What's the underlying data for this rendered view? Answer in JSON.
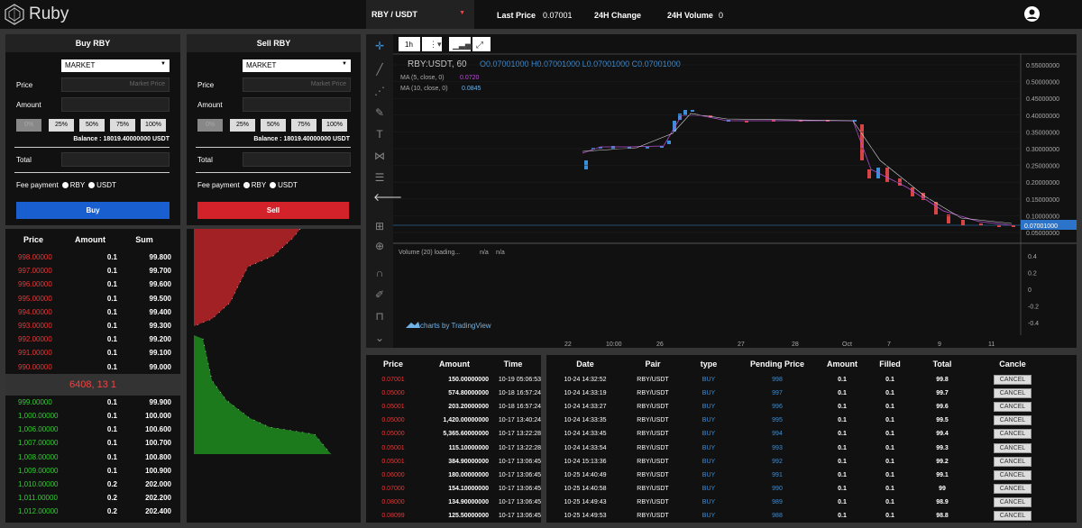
{
  "header": {
    "logo_text": "Ruby",
    "pair": "RBY / USDT",
    "last_price_label": "Last Price",
    "last_price": "0.07001",
    "change_label": "24H Change",
    "volume_label": "24H Volume",
    "volume": "0"
  },
  "buy": {
    "title": "Buy RBY",
    "order_type": "MARKET",
    "price_label": "Price",
    "price_placeholder": "Market Price",
    "amount_label": "Amount",
    "pcts": [
      "0%",
      "25%",
      "50%",
      "75%",
      "100%"
    ],
    "balance": "Balance : 18019.40000000 USDT",
    "total_label": "Total",
    "fee_label": "Fee payment",
    "fee_opt1": "RBY",
    "fee_opt2": "USDT",
    "button": "Buy"
  },
  "sell": {
    "title": "Sell RBY",
    "order_type": "MARKET",
    "price_label": "Price",
    "price_placeholder": "Market Price",
    "amount_label": "Amount",
    "pcts": [
      "0%",
      "25%",
      "50%",
      "75%",
      "100%"
    ],
    "balance": "Balance : 18019.40000000 USDT",
    "total_label": "Total",
    "fee_label": "Fee payment",
    "fee_opt1": "RBY",
    "fee_opt2": "USDT",
    "button": "Sell"
  },
  "orderbook": {
    "headers": [
      "Price",
      "Amount",
      "Sum"
    ],
    "asks": [
      [
        "998.00000",
        "0.1",
        "99.800"
      ],
      [
        "997.00000",
        "0.1",
        "99.700"
      ],
      [
        "996.00000",
        "0.1",
        "99.600"
      ],
      [
        "995.00000",
        "0.1",
        "99.500"
      ],
      [
        "994.00000",
        "0.1",
        "99.400"
      ],
      [
        "993.00000",
        "0.1",
        "99.300"
      ],
      [
        "992.00000",
        "0.1",
        "99.200"
      ],
      [
        "991.00000",
        "0.1",
        "99.100"
      ],
      [
        "990.00000",
        "0.1",
        "99.000"
      ]
    ],
    "mid": "6408, 13 1",
    "bids": [
      [
        "999.00000",
        "0.1",
        "99.900"
      ],
      [
        "1,000.00000",
        "0.1",
        "100.000"
      ],
      [
        "1,006.00000",
        "0.1",
        "100.600"
      ],
      [
        "1,007.00000",
        "0.1",
        "100.700"
      ],
      [
        "1,008.00000",
        "0.1",
        "100.800"
      ],
      [
        "1,009.00000",
        "0.1",
        "100.900"
      ],
      [
        "1,010.00000",
        "0.2",
        "202.000"
      ],
      [
        "1,011.00000",
        "0.2",
        "202.200"
      ],
      [
        "1,012.00000",
        "0.2",
        "202.400"
      ]
    ]
  },
  "chart": {
    "interval": "1h",
    "symbol": "RBY:USDT, 60",
    "ohlc": "O0.07001000  H0.07001000  L0.07001000  C0.07001000",
    "ma5": "MA (5, close, 0)",
    "ma5_val": "0.0720",
    "ma10": "MA (10, close, 0)",
    "ma10_val": "0.0845",
    "volume_label": "Volume (20) loading...",
    "na1": "n/a",
    "na2": "n/a",
    "branding": "charts by TradingView",
    "price_tag": "0.07001000",
    "y_ticks": [
      "0.55000000",
      "0.50000000",
      "0.45000000",
      "0.40000000",
      "0.35000000",
      "0.30000000",
      "0.25000000",
      "0.20000000",
      "0.15000000",
      "0.10000000",
      "0.05000000"
    ],
    "vol_ticks": [
      "0.4",
      "0.2",
      "0",
      "-0.2",
      "-0.4"
    ],
    "x_ticks": [
      "22",
      "10:00",
      "26",
      "27",
      "28",
      "Oct",
      "7",
      "9",
      "11"
    ]
  },
  "trades": {
    "headers": [
      "Price",
      "Amount",
      "Time"
    ],
    "rows": [
      [
        "0.07001",
        "150.00000000",
        "10-19 05:06:53"
      ],
      [
        "0.05000",
        "574.80000000",
        "10-18 16:57:24"
      ],
      [
        "0.05001",
        "203.20000000",
        "10-18 16:57:24"
      ],
      [
        "0.05000",
        "1,420.00000000",
        "10-17 13:40:24"
      ],
      [
        "0.05000",
        "5,365.60000000",
        "10-17 13:22:28"
      ],
      [
        "0.05001",
        "115.10000000",
        "10-17 13:22:28"
      ],
      [
        "0.05001",
        "384.90000000",
        "10-17 13:06:45"
      ],
      [
        "0.06000",
        "180.00000000",
        "10-17 13:06:45"
      ],
      [
        "0.07000",
        "154.10000000",
        "10-17 13:06:45"
      ],
      [
        "0.08000",
        "134.90000000",
        "10-17 13:06:45"
      ],
      [
        "0.08099",
        "125.50000000",
        "10-17 13:06:45"
      ]
    ]
  },
  "orders": {
    "headers": [
      "Date",
      "Pair",
      "type",
      "Pending Price",
      "Amount",
      "Filled",
      "Total",
      "Cancle"
    ],
    "cancel_label": "CANCEL",
    "rows": [
      [
        "10-24 14:32:52",
        "RBY/USDT",
        "BUY",
        "998",
        "0.1",
        "0.1",
        "99.8"
      ],
      [
        "10-24 14:33:19",
        "RBY/USDT",
        "BUY",
        "997",
        "0.1",
        "0.1",
        "99.7"
      ],
      [
        "10-24 14:33:27",
        "RBY/USDT",
        "BUY",
        "996",
        "0.1",
        "0.1",
        "99.6"
      ],
      [
        "10-24 14:33:35",
        "RBY/USDT",
        "BUY",
        "995",
        "0.1",
        "0.1",
        "99.5"
      ],
      [
        "10-24 14:33:45",
        "RBY/USDT",
        "BUY",
        "994",
        "0.1",
        "0.1",
        "99.4"
      ],
      [
        "10-24 14:33:54",
        "RBY/USDT",
        "BUY",
        "993",
        "0.1",
        "0.1",
        "99.3"
      ],
      [
        "10-24 15:13:36",
        "RBY/USDT",
        "BUY",
        "992",
        "0.1",
        "0.1",
        "99.2"
      ],
      [
        "10-25 14:40:49",
        "RBY/USDT",
        "BUY",
        "991",
        "0.1",
        "0.1",
        "99.1"
      ],
      [
        "10-25 14:40:58",
        "RBY/USDT",
        "BUY",
        "990",
        "0.1",
        "0.1",
        "99"
      ],
      [
        "10-25 14:49:43",
        "RBY/USDT",
        "BUY",
        "989",
        "0.1",
        "0.1",
        "98.9"
      ],
      [
        "10-25 14:49:53",
        "RBY/USDT",
        "BUY",
        "988",
        "0.1",
        "0.1",
        "98.8"
      ]
    ]
  }
}
